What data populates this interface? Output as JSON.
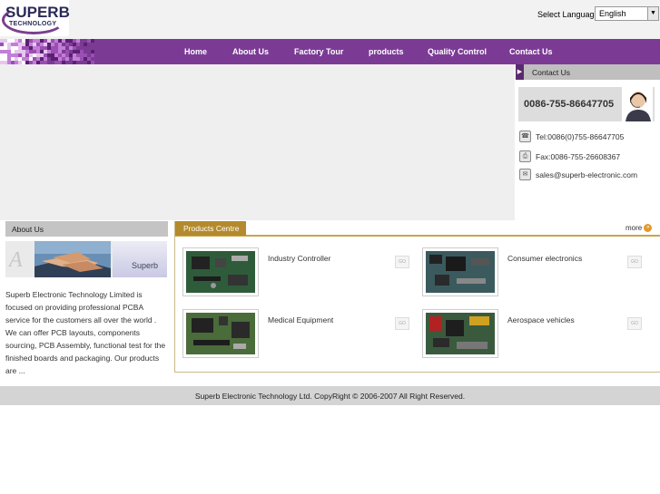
{
  "brand": {
    "name": "SUPERB",
    "tagline": "TECHNOLOGY"
  },
  "language": {
    "label": "Select Language:",
    "selected": "English"
  },
  "nav": {
    "items": [
      {
        "label": "Home"
      },
      {
        "label": "About Us"
      },
      {
        "label": "Factory Tour"
      },
      {
        "label": "products"
      },
      {
        "label": "Quality Control"
      },
      {
        "label": "Contact Us"
      }
    ]
  },
  "contact": {
    "title": "Contact Us",
    "phone_banner": "0086-755-86647705",
    "tel": "Tel:0086(0)755-86647705",
    "fax": "Fax:0086-755-26608367",
    "email": "sales@superb-electronic.com"
  },
  "about": {
    "title": "About Us",
    "image_badge": "Superb",
    "text": "Superb Electronic Technology Limited is focused on providing professional PCBA service for the customers all over the world . We can offer PCB layouts, components sourcing, PCB Assembly, functional test for the finished boards and packaging. Our products are ..."
  },
  "products": {
    "title": "Products Centre",
    "more_label": "more",
    "go_label": "GO",
    "items": [
      {
        "name": "Industry Controller"
      },
      {
        "name": "Consumer electronics"
      },
      {
        "name": "Medical Equipment"
      },
      {
        "name": "Aerospace vehicles"
      }
    ]
  },
  "footer": {
    "copyright": "Superb Electronic Technology Ltd. CopyRight © 2006-2007 All Right Reserved."
  },
  "colors": {
    "nav": "#7b3b95",
    "accent": "#b48a2c",
    "panel_gray": "#c4c4c4",
    "footer": "#d4d4d4"
  }
}
